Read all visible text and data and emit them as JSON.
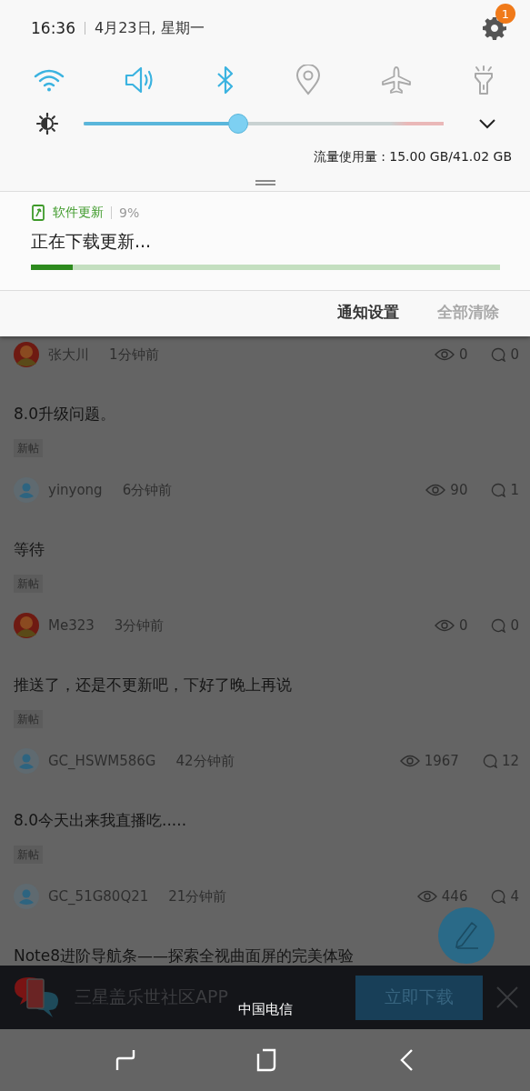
{
  "status": {
    "time": "16:36",
    "date": "4月23日, 星期一",
    "settings_badge": "1"
  },
  "toggles": [
    {
      "kind": "wifi",
      "on": true
    },
    {
      "kind": "sound",
      "on": true
    },
    {
      "kind": "bluetooth",
      "on": true
    },
    {
      "kind": "location",
      "on": false
    },
    {
      "kind": "airplane",
      "on": false
    },
    {
      "kind": "flashlight",
      "on": false
    }
  ],
  "brightness": {
    "level": 0.43
  },
  "data_usage": "流量使用量 : 15.00 GB/41.02 GB",
  "notification": {
    "app": "软件更新",
    "percent": "9%",
    "title": "正在下载更新...",
    "level": 0.09
  },
  "notification_actions": [
    {
      "label": "通知设置",
      "disabled": false
    },
    {
      "label": "全部清除",
      "disabled": true
    }
  ],
  "feed": [
    {
      "author": "张大川",
      "time": "1分钟前",
      "views": "0",
      "comments": "0"
    },
    {
      "title": "8.0升级问题。",
      "tag": "新帖",
      "avatar": {
        "kind": "default"
      },
      "author": "yinyong",
      "time": "6分钟前",
      "views": "90",
      "comments": "1"
    },
    {
      "title": "等待",
      "tag": "新帖",
      "author": "Me323",
      "time": "3分钟前",
      "views": "0",
      "comments": "0"
    },
    {
      "title": "推送了，还是不更新吧，下好了晚上再说",
      "tag": "新帖",
      "avatar": {
        "kind": "default"
      },
      "author": "GC_HSWM586G",
      "time": "42分钟前",
      "views": "1967",
      "comments": "12"
    },
    {
      "title": "8.0今天出来我直播吃.....",
      "tag": "新帖",
      "avatar": {
        "kind": "default"
      },
      "author": "GC_51G80Q21",
      "time": "21分钟前",
      "views": "446",
      "comments": "4"
    },
    {
      "title": "Note8进阶导航条——探索全视曲面屏的完美体验"
    }
  ],
  "ad": {
    "title": "三星盖乐世社区APP",
    "button": "立即下载"
  },
  "carrier": "中国电信"
}
